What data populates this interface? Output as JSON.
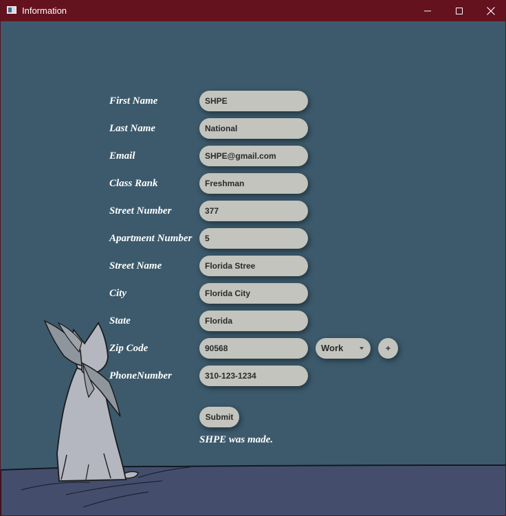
{
  "window": {
    "title": "Information"
  },
  "form": {
    "fields": [
      {
        "label": "First Name",
        "value": "SHPE"
      },
      {
        "label": "Last Name",
        "value": "National"
      },
      {
        "label": "Email",
        "value": "SHPE@gmail.com"
      },
      {
        "label": "Class Rank",
        "value": "Freshman"
      },
      {
        "label": "Street Number",
        "value": "377"
      },
      {
        "label": "Apartment Number",
        "value": "5"
      },
      {
        "label": "Street Name",
        "value": "Florida Stree"
      },
      {
        "label": "City",
        "value": "Florida City"
      },
      {
        "label": "State",
        "value": "Florida"
      },
      {
        "label": "Zip Code",
        "value": "90568"
      },
      {
        "label": "PhoneNumber",
        "value": "310-123-1234"
      }
    ],
    "phone_type": "Work",
    "add_label": "+",
    "submit_label": "Submit",
    "status": "SHPE was made."
  },
  "colors": {
    "titlebar": "#63121e",
    "background": "#3c5a6c",
    "field": "#c2c4bd",
    "ground": "#444e6c"
  }
}
